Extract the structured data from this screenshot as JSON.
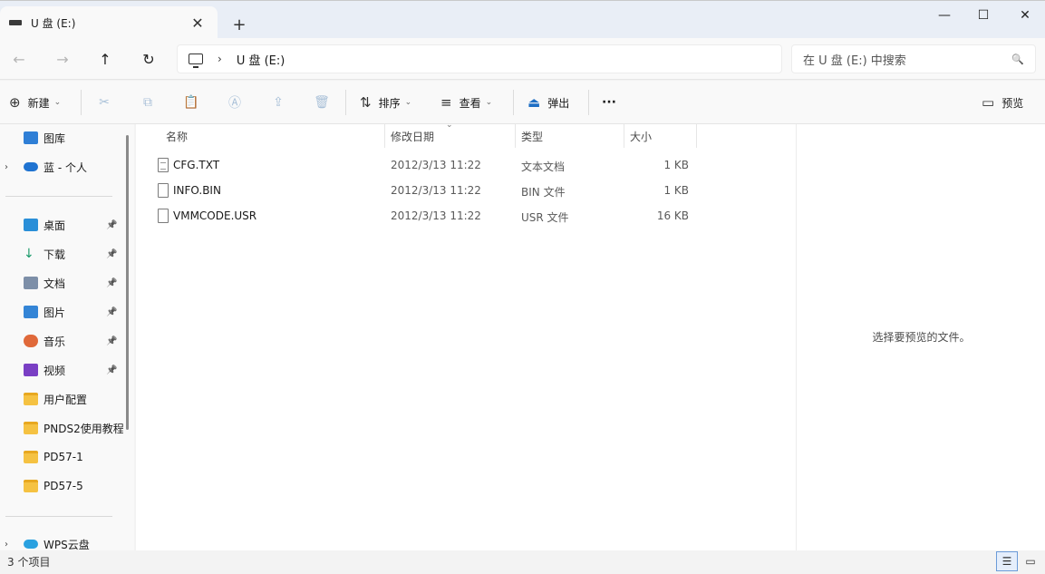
{
  "window": {
    "tab_title": "U 盘 (E:)",
    "tab_close": "✕",
    "new_tab": "+",
    "minimize": "—",
    "maximize": "☐",
    "close": "✕"
  },
  "nav": {
    "back": "←",
    "forward": "→",
    "up": "↑",
    "refresh": "↻"
  },
  "address": {
    "breadcrumb_separator": "›",
    "crumb": "U 盘 (E:)"
  },
  "search": {
    "placeholder": "在 U 盘 (E:) 中搜索",
    "icon": "🔍"
  },
  "toolbar": {
    "new_label": "新建",
    "sort_label": "排序",
    "view_label": "查看",
    "eject_label": "弹出",
    "more_label": "···",
    "preview_label": "预览",
    "icons": {
      "new": "⊕",
      "cut": "✂",
      "copy": "⧉",
      "paste": "📋",
      "rename": "Ⓐ",
      "share": "⇪",
      "delete": "🗑",
      "sort": "⇅",
      "view": "≡",
      "eject": "⏏",
      "preview": "▭",
      "caret": "⌄"
    }
  },
  "sidebar": {
    "expander": "›",
    "pin": "📌",
    "items": [
      {
        "label": "图库",
        "icon": "gallery-icon"
      },
      {
        "label": "蓝 - 个人",
        "icon": "onedrive-icon"
      },
      {
        "label": "桌面",
        "icon": "desktop-icon"
      },
      {
        "label": "下载",
        "icon": "download-icon"
      },
      {
        "label": "文档",
        "icon": "documents-icon"
      },
      {
        "label": "图片",
        "icon": "pictures-icon"
      },
      {
        "label": "音乐",
        "icon": "music-icon"
      },
      {
        "label": "视频",
        "icon": "videos-icon"
      },
      {
        "label": "用户配置",
        "icon": "folder-icon"
      },
      {
        "label": "PNDS2使用教程",
        "icon": "folder-icon"
      },
      {
        "label": "PD57-1",
        "icon": "folder-icon"
      },
      {
        "label": "PD57-5",
        "icon": "folder-icon"
      },
      {
        "label": "WPS云盘",
        "icon": "wps-cloud-icon"
      }
    ]
  },
  "columns": {
    "name": "名称",
    "date": "修改日期",
    "type": "类型",
    "size": "大小",
    "sort_caret": "⌄"
  },
  "files": [
    {
      "name": "CFG.TXT",
      "date": "2012/3/13 11:22",
      "type": "文本文档",
      "size": "1 KB"
    },
    {
      "name": "INFO.BIN",
      "date": "2012/3/13 11:22",
      "type": "BIN 文件",
      "size": "1 KB"
    },
    {
      "name": "VMMCODE.USR",
      "date": "2012/3/13 11:22",
      "type": "USR 文件",
      "size": "16 KB"
    }
  ],
  "preview": {
    "message": "选择要预览的文件。"
  },
  "status": {
    "count": "3 个项目",
    "details_view": "☰",
    "tiles_view": "▭"
  }
}
